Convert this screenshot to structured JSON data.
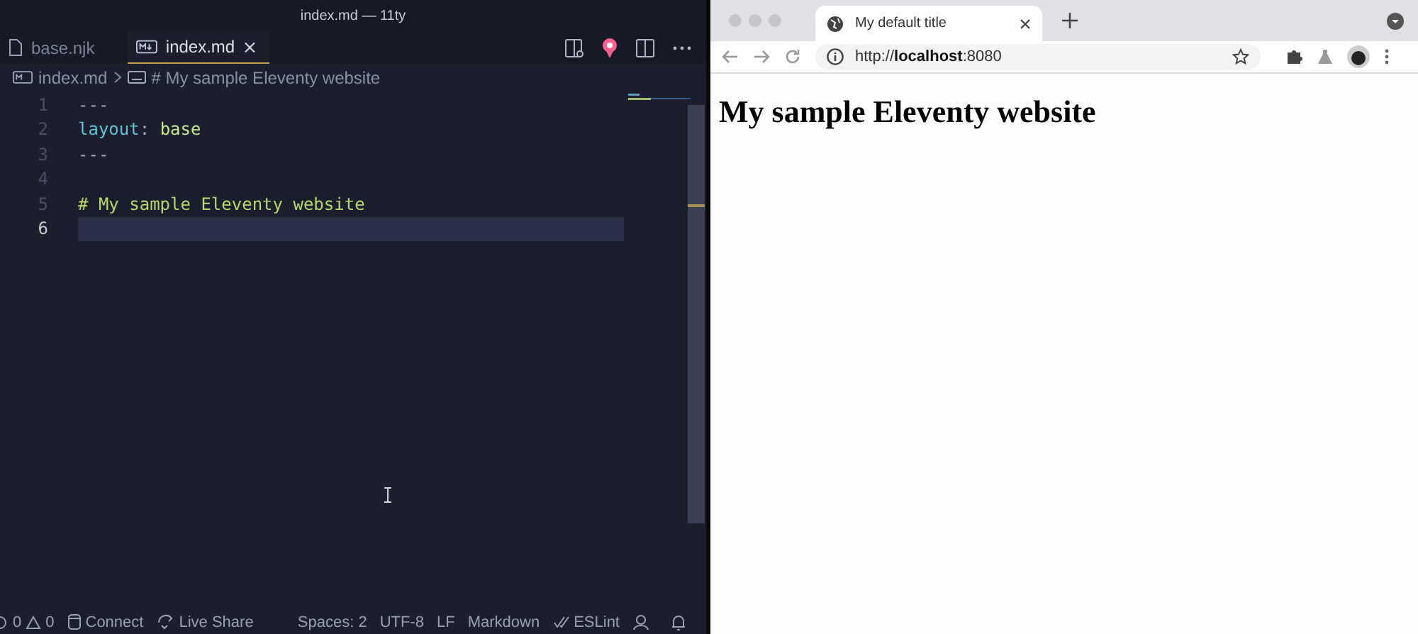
{
  "editor": {
    "window_title": "index.md — 11ty",
    "tabs": [
      {
        "label": "base.njk",
        "kind": "file",
        "selected": false
      },
      {
        "label": "index.md",
        "kind": "markdown",
        "selected": true
      }
    ],
    "breadcrumbs": [
      {
        "label": "index.md",
        "kind": "markdown"
      },
      {
        "label": "# My sample Eleventy website",
        "kind": "symbol"
      }
    ],
    "lines": [
      {
        "number": "1",
        "selected": false,
        "tokens": [
          {
            "kind": "punct",
            "text": "---"
          }
        ]
      },
      {
        "number": "2",
        "selected": false,
        "tokens": [
          {
            "kind": "key",
            "text": "layout"
          },
          {
            "kind": "punct",
            "text": ": "
          },
          {
            "kind": "value",
            "text": "base"
          }
        ]
      },
      {
        "number": "3",
        "selected": false,
        "tokens": [
          {
            "kind": "punct",
            "text": "---"
          }
        ]
      },
      {
        "number": "4",
        "selected": false
      },
      {
        "number": "5",
        "selected": false,
        "tokens": [
          {
            "kind": "heading",
            "text": "# My sample Eleventy website"
          }
        ]
      },
      {
        "number": "6",
        "selected": true
      }
    ],
    "status_bar": {
      "errors": "0",
      "warnings": "0",
      "items": [
        {
          "label": "Connect",
          "kind": "remote"
        },
        {
          "label": "Live Share",
          "kind": "share"
        }
      ],
      "right_items": [
        {
          "label": "Spaces: 2",
          "kind": "text"
        },
        {
          "label": "UTF-8",
          "kind": "text"
        },
        {
          "label": "LF",
          "kind": "text"
        },
        {
          "label": "Markdown",
          "kind": "text"
        },
        {
          "label": "ESLint",
          "kind": "lint"
        }
      ]
    }
  },
  "browser": {
    "tab_title": "My default title",
    "url": "http://**localhost**:8080",
    "heading": "My sample Eleventy website"
  }
}
